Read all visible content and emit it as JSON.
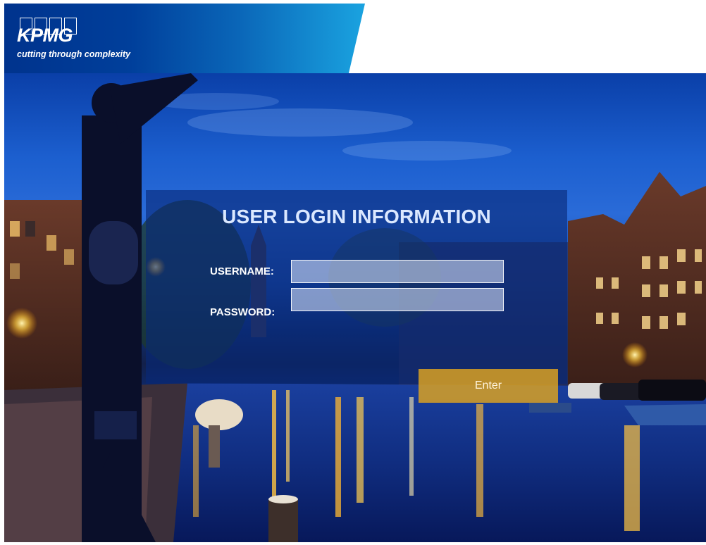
{
  "header": {
    "logo_text": "KPMG",
    "tagline": "cutting through complexity"
  },
  "login": {
    "title": "USER LOGIN INFORMATION",
    "username_label": "USERNAME:",
    "password_label": "PASSWORD:",
    "username_value": "",
    "password_value": "",
    "enter_label": "Enter"
  },
  "colors": {
    "brand_blue": "#00338d",
    "accent_light_blue": "#1aa3e0",
    "enter_button": "#e1a51e"
  }
}
